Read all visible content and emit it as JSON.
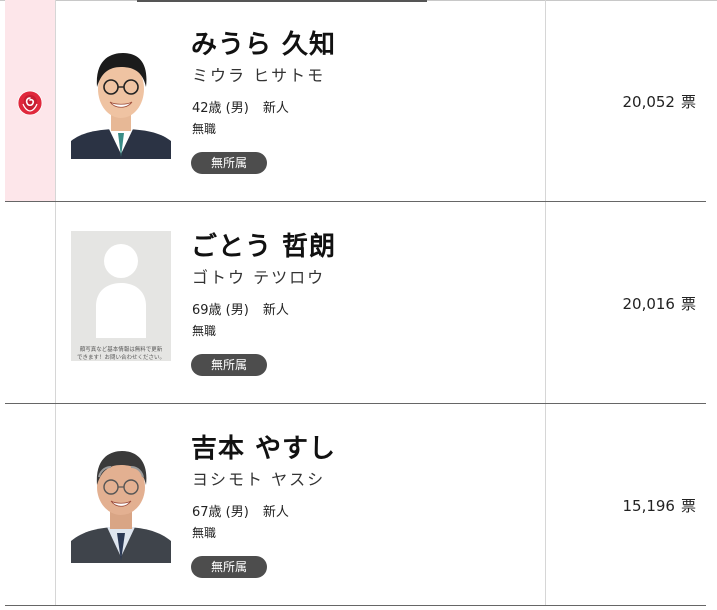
{
  "candidates": [
    {
      "name": "みうら 久知",
      "kana": "ミウラ ヒサトモ",
      "age": "42歳 (男)",
      "status": "新人",
      "job": "無職",
      "party": "無所属",
      "votes": "20,052",
      "vote_unit": "票",
      "elected": true,
      "photo": "candidate-photo"
    },
    {
      "name": "ごとう 哲朗",
      "kana": "ゴトウ テツロウ",
      "age": "69歳 (男)",
      "status": "新人",
      "job": "無職",
      "party": "無所属",
      "votes": "20,016",
      "vote_unit": "票",
      "elected": false,
      "photo": "no-photo-placeholder",
      "photo_note_line1": "顔写真など基本情報は無料で更新",
      "photo_note_line2": "できます！お問い合わせください。"
    },
    {
      "name": "吉本 やすし",
      "kana": "ヨシモト ヤスシ",
      "age": "67歳 (男)",
      "status": "新人",
      "job": "無職",
      "party": "無所属",
      "votes": "15,196",
      "vote_unit": "票",
      "elected": false,
      "photo": "candidate-photo"
    }
  ],
  "colors": {
    "winner_bg": "#fde6ea",
    "rose": "#e0283c",
    "party_badge": "#4d4d4d"
  },
  "icons": {
    "elected": "rose-icon"
  }
}
